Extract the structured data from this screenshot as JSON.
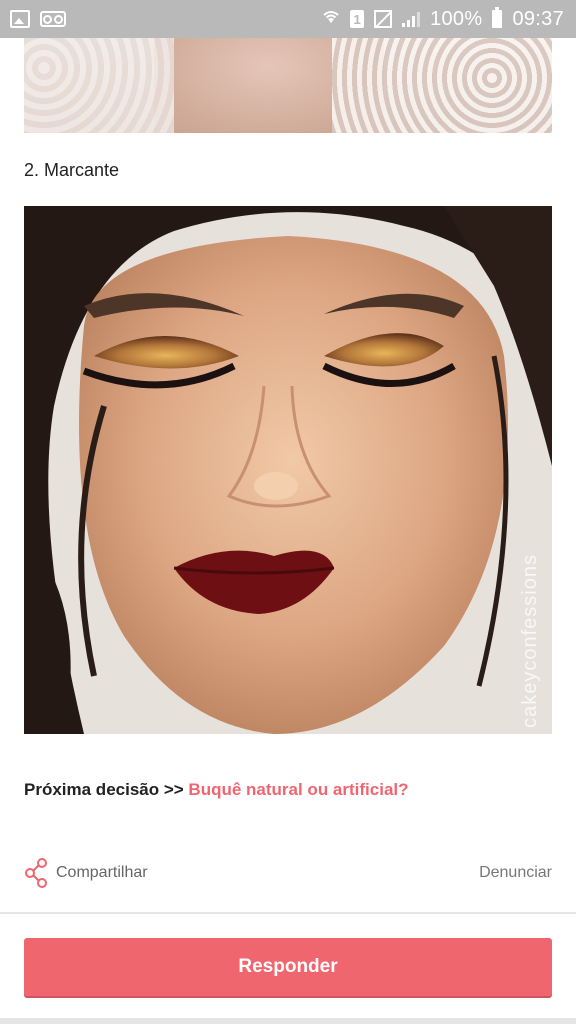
{
  "status_bar": {
    "battery": "100%",
    "time": "09:37",
    "sim_slot": "1"
  },
  "post": {
    "item_title": "2. Marcante",
    "watermark": "cakeyconfessions",
    "next_decision_prefix": "Próxima decisão >> ",
    "next_decision_link": "Buquê natural ou artificial?"
  },
  "actions": {
    "share_label": "Compartilhar",
    "report_label": "Denunciar",
    "respond_label": "Responder"
  },
  "colors": {
    "accent": "#f0666f",
    "status_bar": "#b9b9b9"
  }
}
